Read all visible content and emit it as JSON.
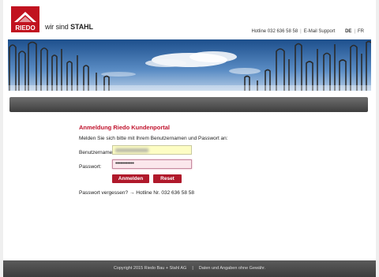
{
  "brand": {
    "logo_text": "RIEDO",
    "slogan_prefix": "wir sind",
    "slogan_emphasis": "STAHL"
  },
  "topnav": {
    "hotline": "Hotline 032 636 58 58",
    "email_support": "E-Mail Support",
    "lang_de": "DE",
    "lang_fr": "FR",
    "active_lang": "DE"
  },
  "login": {
    "title": "Anmeldung Riedo Kundenportal",
    "intro": "Melden Sie sich bitte mit Ihrem Benutzernamen und Passwort an:",
    "username_label": "Benutzername:",
    "username_value": "(blurred)",
    "password_label": "Passwort:",
    "password_value": "••••••••••••",
    "login_button": "Anmelden",
    "reset_button": "Reset",
    "forgot_text": "Passwort vergessen? → Hotline Nr. 032 636 58 58"
  },
  "footer": {
    "copyright": "Copyright 2015 Riedo Bau + Stahl AG",
    "disclaimer": "Daten und Angaben ohne Gewähr."
  },
  "colors": {
    "accent": "#b0192b",
    "title": "#c0122c",
    "navbar": "#4a4a4a",
    "footer": "#4a4a4a"
  }
}
